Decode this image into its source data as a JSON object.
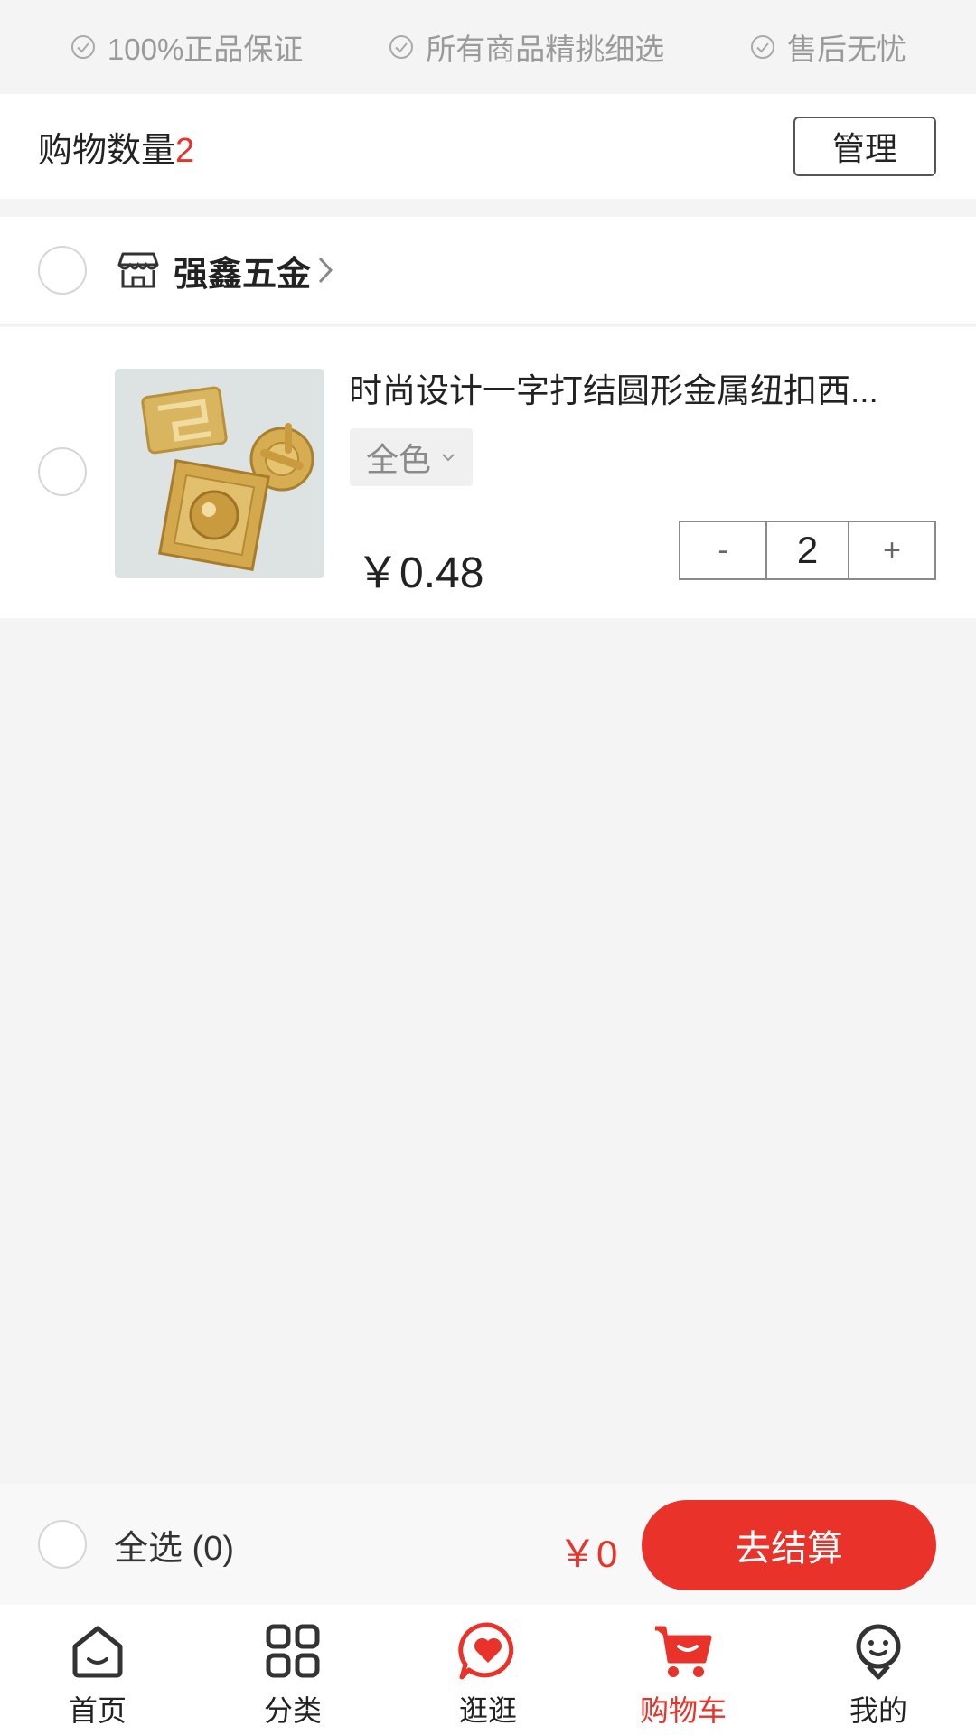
{
  "guarantees": [
    "100%正品保证",
    "所有商品精挑细选",
    "售后无忧"
  ],
  "cart_header": {
    "count_label": "购物数量",
    "count": "2",
    "manage_label": "管理"
  },
  "store": {
    "name": "强鑫五金"
  },
  "item": {
    "title": "时尚设计一字打结圆形金属纽扣西...",
    "spec": "全色",
    "price": "￥0.48",
    "quantity": "2",
    "minus": "-",
    "plus": "+"
  },
  "checkout": {
    "select_all": "全选 (0)",
    "total": "￥0",
    "button": "去结算"
  },
  "tabs": [
    {
      "label": "首页",
      "icon": "home-icon"
    },
    {
      "label": "分类",
      "icon": "category-icon"
    },
    {
      "label": "逛逛",
      "icon": "heart-chat-icon"
    },
    {
      "label": "购物车",
      "icon": "cart-icon",
      "active": true
    },
    {
      "label": "我的",
      "icon": "profile-icon"
    }
  ],
  "colors": {
    "accent": "#e8322a",
    "background": "#f4f4f4"
  }
}
